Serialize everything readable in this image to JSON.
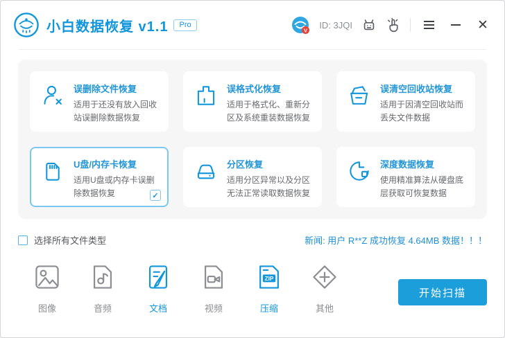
{
  "titlebar": {
    "app_title": "小白数据恢复 v1.1",
    "badge": "Pro",
    "user_id": "ID: 3JQI"
  },
  "cards": [
    {
      "title": "误删除文件恢复",
      "desc": "适用于还没有放入回收站误删除数据恢复",
      "icon": "user-x-icon",
      "selected": false
    },
    {
      "title": "误格式化恢复",
      "desc": "适用于格式化、重新分区及系统重装数据恢复",
      "icon": "format-drive-icon",
      "selected": false
    },
    {
      "title": "误清空回收站恢复",
      "desc": "适用于因清空回收站而丢失文件数据",
      "icon": "recycle-bin-icon",
      "selected": false
    },
    {
      "title": "U盘/内存卡恢复",
      "desc": "适用U盘或内存卡误删除数据恢复",
      "icon": "sd-card-icon",
      "selected": true
    },
    {
      "title": "分区恢复",
      "desc": "适用分区异常以及分区无法正常读取数据恢复",
      "icon": "hard-drive-icon",
      "selected": false
    },
    {
      "title": "深度数据恢复",
      "desc": "使用精准算法从硬盘底层获取可恢复数据",
      "icon": "deep-scan-icon",
      "selected": false
    }
  ],
  "card_check_glyph": "✓",
  "options": {
    "select_all_label": "选择所有文件类型",
    "news": "新闻: 用户 R**Z 成功恢复 4.64MB 数据！！！"
  },
  "file_types": [
    {
      "label": "图像",
      "selected": false
    },
    {
      "label": "音频",
      "selected": false
    },
    {
      "label": "文档",
      "selected": true
    },
    {
      "label": "视频",
      "selected": false
    },
    {
      "label": "压缩",
      "selected": true
    },
    {
      "label": "其他",
      "selected": false
    }
  ],
  "zip_badge": "ZIP",
  "avatar_badge": "V",
  "scan_button_label": "开始扫描",
  "colors": {
    "accent": "#1296db",
    "button": "#1b9ed9",
    "selected_card_border": "#7ac8ef",
    "news_text": "#1e8fd2"
  }
}
